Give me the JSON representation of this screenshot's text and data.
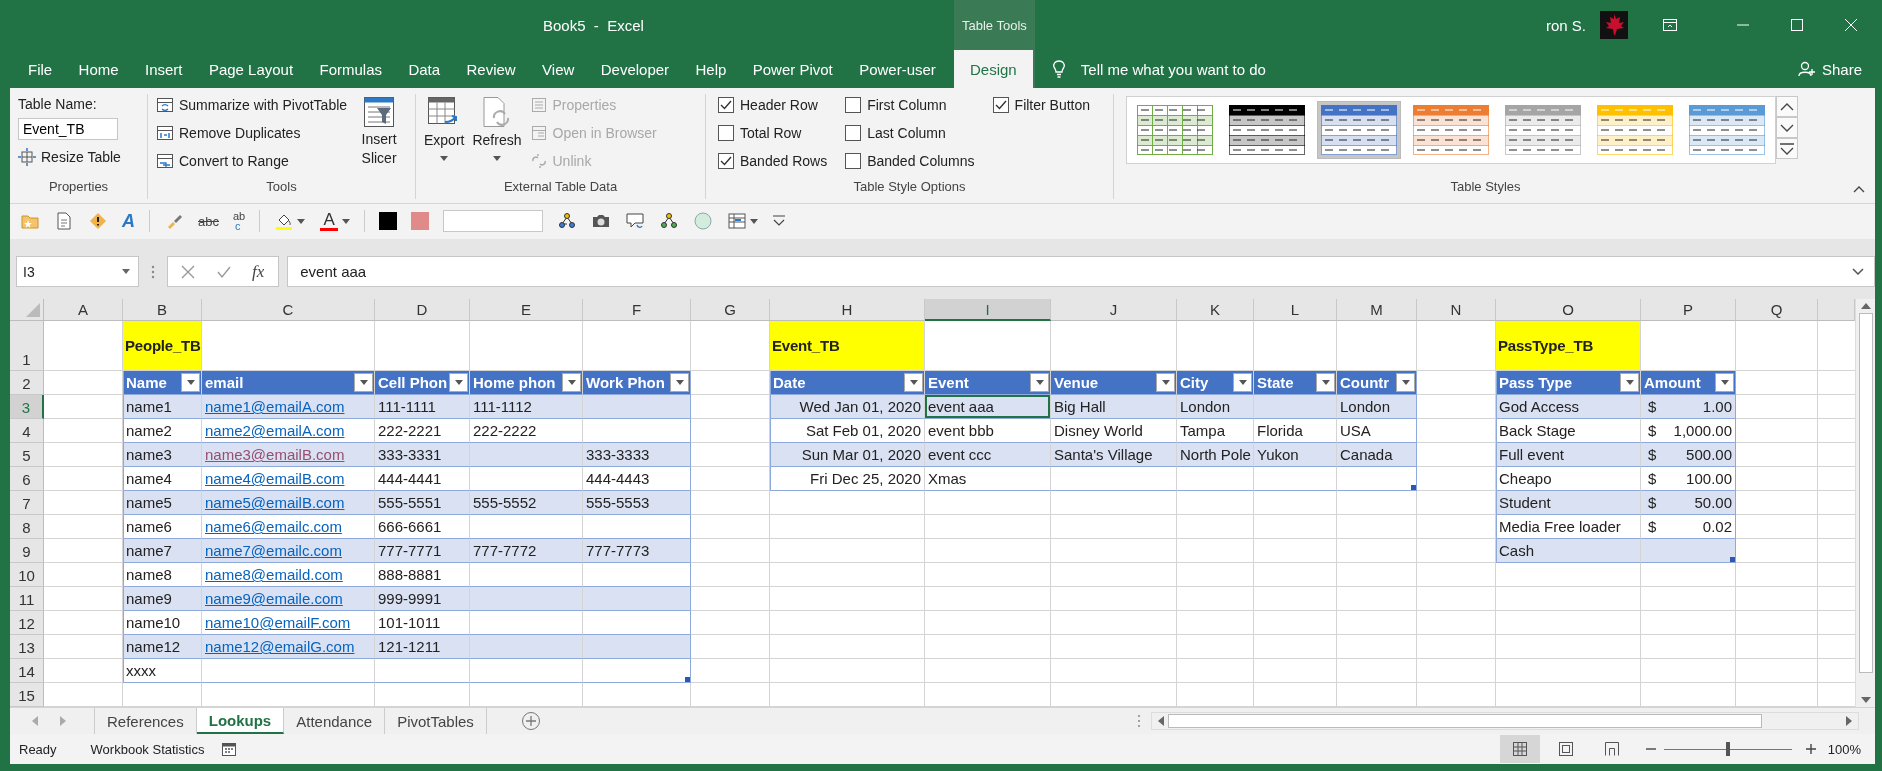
{
  "window": {
    "title": "Book5  -  Excel",
    "user": "ron S."
  },
  "ribbon": {
    "context_label": "Table Tools",
    "tabs": [
      {
        "label": "File",
        "selected": false
      },
      {
        "label": "Home",
        "selected": false
      },
      {
        "label": "Insert",
        "selected": false
      },
      {
        "label": "Page Layout",
        "selected": false
      },
      {
        "label": "Formulas",
        "selected": false
      },
      {
        "label": "Data",
        "selected": false
      },
      {
        "label": "Review",
        "selected": false
      },
      {
        "label": "View",
        "selected": false
      },
      {
        "label": "Developer",
        "selected": false
      },
      {
        "label": "Help",
        "selected": false
      },
      {
        "label": "Power Pivot",
        "selected": false
      },
      {
        "label": "Power-user",
        "selected": false
      },
      {
        "label": "Design",
        "selected": true
      }
    ],
    "tell_me": "Tell me what you want to do",
    "share": "Share",
    "properties": {
      "label": "Properties",
      "table_name_label": "Table Name:",
      "table_name": "Event_TB",
      "resize": "Resize Table"
    },
    "tools": {
      "label": "Tools",
      "items": [
        "Summarize with PivotTable",
        "Remove Duplicates",
        "Convert to Range"
      ],
      "slicer": "Insert Slicer"
    },
    "external": {
      "label": "External Table Data",
      "export": "Export",
      "refresh": "Refresh",
      "items": [
        {
          "label": "Properties",
          "disabled": true
        },
        {
          "label": "Open in Browser",
          "disabled": true
        },
        {
          "label": "Unlink",
          "disabled": true
        }
      ]
    },
    "style_options": {
      "label": "Table Style Options",
      "options": [
        {
          "label": "Header Row",
          "checked": true
        },
        {
          "label": "Total Row",
          "checked": false
        },
        {
          "label": "Banded Rows",
          "checked": true
        },
        {
          "label": "First Column",
          "checked": false
        },
        {
          "label": "Last Column",
          "checked": false
        },
        {
          "label": "Banded Columns",
          "checked": false
        },
        {
          "label": "Filter Button",
          "checked": true
        }
      ]
    },
    "table_styles": {
      "label": "Table Styles",
      "styles": [
        {
          "kind": "grid",
          "color": "#70ad47",
          "selected": false
        },
        {
          "kind": "banded",
          "color": "#000000",
          "selected": false
        },
        {
          "kind": "banded",
          "color": "#4472c4",
          "selected": true
        },
        {
          "kind": "banded",
          "color": "#ed7d31",
          "selected": false
        },
        {
          "kind": "banded",
          "color": "#a5a5a5",
          "selected": false
        },
        {
          "kind": "banded",
          "color": "#ffc000",
          "selected": false
        },
        {
          "kind": "banded",
          "color": "#5b9bd5",
          "selected": false
        }
      ]
    }
  },
  "quick_access": {
    "spelling_glyph": "A",
    "strikethrough_glyph": "abc",
    "change_case_top": "ab",
    "change_case_bottom": "c",
    "font_color_glyph": "A"
  },
  "formula_bar": {
    "name_box": "I3",
    "function_label": "fx",
    "value": "event aaa"
  },
  "sheet": {
    "column_headers": [
      {
        "label": "A",
        "selected": false
      },
      {
        "label": "B",
        "selected": false
      },
      {
        "label": "C",
        "selected": false
      },
      {
        "label": "D",
        "selected": false
      },
      {
        "label": "E",
        "selected": false
      },
      {
        "label": "F",
        "selected": false
      },
      {
        "label": "G",
        "selected": false
      },
      {
        "label": "H",
        "selected": false
      },
      {
        "label": "I",
        "selected": true
      },
      {
        "label": "J",
        "selected": false
      },
      {
        "label": "K",
        "selected": false
      },
      {
        "label": "L",
        "selected": false
      },
      {
        "label": "M",
        "selected": false
      },
      {
        "label": "N",
        "selected": false
      },
      {
        "label": "O",
        "selected": false
      },
      {
        "label": "P",
        "selected": false
      },
      {
        "label": "Q",
        "selected": false
      }
    ],
    "row_headers": [
      {
        "label": "1",
        "selected": false
      },
      {
        "label": "2",
        "selected": false
      },
      {
        "label": "3",
        "selected": true
      },
      {
        "label": "4",
        "selected": false
      },
      {
        "label": "5",
        "selected": false
      },
      {
        "label": "6",
        "selected": false
      },
      {
        "label": "7",
        "selected": false
      },
      {
        "label": "8",
        "selected": false
      },
      {
        "label": "9",
        "selected": false
      },
      {
        "label": "10",
        "selected": false
      },
      {
        "label": "11",
        "selected": false
      },
      {
        "label": "12",
        "selected": false
      },
      {
        "label": "13",
        "selected": false
      },
      {
        "label": "14",
        "selected": false
      },
      {
        "label": "15",
        "selected": false
      }
    ],
    "tables": [
      {
        "title": "People_TB",
        "columns": [
          {
            "label": "Name",
            "kind": "text"
          },
          {
            "label": "email",
            "kind": "link"
          },
          {
            "label": "Cell Phon",
            "kind": "text"
          },
          {
            "label": "Home phon",
            "kind": "text"
          },
          {
            "label": "Work Phon",
            "kind": "text"
          }
        ],
        "rows": [
          [
            "name1",
            {
              "text": "name1@emailA.com",
              "visited": false
            },
            "111-1111",
            "111-1112",
            null
          ],
          [
            "name2",
            {
              "text": "name2@emailA.com",
              "visited": false
            },
            "222-2221",
            "222-2222",
            null
          ],
          [
            "name3",
            {
              "text": "name3@emailB.com",
              "visited": true
            },
            "333-3331",
            null,
            "333-3333"
          ],
          [
            "name4",
            {
              "text": "name4@emailB.com",
              "visited": false
            },
            "444-4441",
            null,
            "444-4443"
          ],
          [
            "name5",
            {
              "text": "name5@emailB.com",
              "visited": false
            },
            "555-5551",
            "555-5552",
            "555-5553"
          ],
          [
            "name6",
            {
              "text": "name6@emailc.com",
              "visited": false
            },
            "666-6661",
            null,
            null
          ],
          [
            "name7",
            {
              "text": "name7@emailc.com",
              "visited": false
            },
            "777-7771",
            "777-7772",
            "777-7773"
          ],
          [
            "name8",
            {
              "text": "name8@emaild.com",
              "visited": false
            },
            "888-8881",
            null,
            null
          ],
          [
            "name9",
            {
              "text": "name9@emaile.com",
              "visited": false
            },
            "999-9991",
            null,
            null
          ],
          [
            "name10",
            {
              "text": "name10@emailF.com",
              "visited": false
            },
            "101-1011",
            null,
            null
          ],
          [
            "name12",
            {
              "text": "name12@emailG.com",
              "visited": false
            },
            "121-1211",
            null,
            null
          ],
          [
            "xxxx",
            null,
            null,
            null,
            null
          ]
        ]
      },
      {
        "title": "Event_TB",
        "columns": [
          {
            "label": "Date",
            "kind": "date"
          },
          {
            "label": "Event",
            "kind": "text"
          },
          {
            "label": "Venue",
            "kind": "text"
          },
          {
            "label": "City",
            "kind": "text"
          },
          {
            "label": "State",
            "kind": "text"
          },
          {
            "label": "Countr",
            "kind": "text"
          }
        ],
        "rows": [
          [
            "Wed Jan 01, 2020",
            "event aaa",
            "Big Hall",
            "London",
            null,
            "London"
          ],
          [
            "Sat Feb 01, 2020",
            "event bbb",
            "Disney World",
            "Tampa",
            "Florida",
            "USA"
          ],
          [
            "Sun Mar 01, 2020",
            "event ccc",
            "Santa's Village",
            "North Pole",
            "Yukon",
            "Canada"
          ],
          [
            "Fri Dec 25, 2020",
            "Xmas",
            null,
            null,
            null,
            null
          ]
        ]
      },
      {
        "title": "PassType_TB",
        "columns": [
          {
            "label": "Pass Type",
            "kind": "text"
          },
          {
            "label": "Amount",
            "kind": "currency"
          }
        ],
        "rows": [
          [
            "God Access",
            {
              "symbol": "$",
              "amount": "1.00"
            }
          ],
          [
            "Back Stage",
            {
              "symbol": "$",
              "amount": "1,000.00"
            }
          ],
          [
            "Full event",
            {
              "symbol": "$",
              "amount": "500.00"
            }
          ],
          [
            "Cheapo",
            {
              "symbol": "$",
              "amount": "100.00"
            }
          ],
          [
            "Student",
            {
              "symbol": "$",
              "amount": "50.00"
            }
          ],
          [
            "Media Free loader",
            {
              "symbol": "$",
              "amount": "0.02"
            }
          ],
          [
            "Cash",
            null
          ]
        ]
      }
    ]
  },
  "sheet_tabs": [
    {
      "label": "References",
      "selected": false
    },
    {
      "label": "Lookups",
      "selected": true
    },
    {
      "label": "Attendance",
      "selected": false
    },
    {
      "label": "PivotTables",
      "selected": false
    }
  ],
  "status_bar": {
    "mode": "Ready",
    "statistics": "Workbook Statistics",
    "views": [
      {
        "kind": "normal",
        "selected": true
      },
      {
        "kind": "page_layout",
        "selected": false
      },
      {
        "kind": "page_break",
        "selected": false
      }
    ],
    "zoom": {
      "level": 0.5,
      "reading": "100%"
    }
  }
}
